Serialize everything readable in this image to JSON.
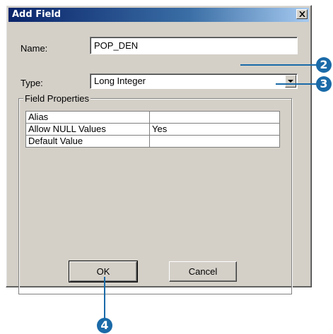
{
  "window": {
    "title": "Add Field",
    "close_glyph": "close-icon"
  },
  "form": {
    "name_label": "Name:",
    "name_value": "POP_DEN",
    "type_label": "Type:",
    "type_value": "Long Integer"
  },
  "field_properties": {
    "legend": "Field Properties",
    "rows": [
      {
        "property": "Alias",
        "value": ""
      },
      {
        "property": "Allow NULL Values",
        "value": "Yes"
      },
      {
        "property": "Default Value",
        "value": ""
      }
    ]
  },
  "buttons": {
    "ok_label": "OK",
    "cancel_label": "Cancel"
  },
  "callouts": {
    "name_step": "2",
    "type_step": "3",
    "ok_step": "4",
    "color": "#1a6aa8"
  }
}
